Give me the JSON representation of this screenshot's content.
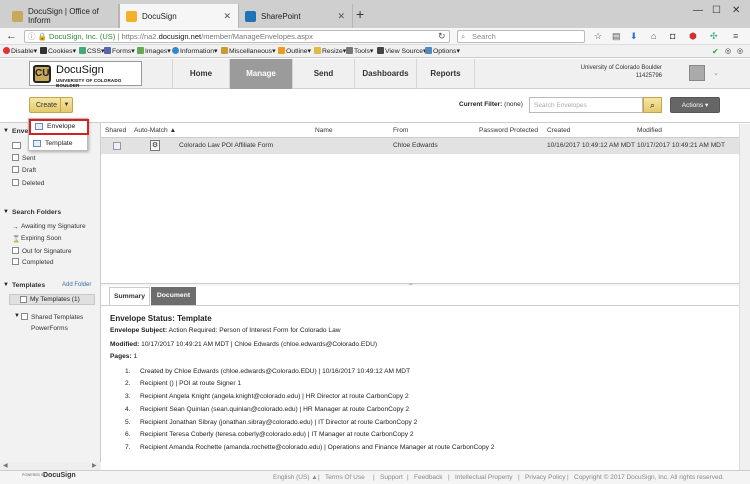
{
  "browser": {
    "tabs": [
      {
        "title": "DocuSign | Office of Inform"
      },
      {
        "title": "DocuSign"
      },
      {
        "title": "SharePoint"
      }
    ],
    "url_site": "DocuSign, Inc. (US)",
    "url_prefix": "https://na2.",
    "url_domain": "docusign.net",
    "url_path": "/member/ManageEnvelopes.aspx",
    "search_placeholder": "Search"
  },
  "devtoolbar": [
    "Disable",
    "Cookies",
    "CSS",
    "Forms",
    "Images",
    "Information",
    "Miscellaneous",
    "Outline",
    "Resize",
    "Tools",
    "View Source",
    "Options"
  ],
  "header": {
    "brand": "DocuSign",
    "brand_sub": "UNIVERSITY OF COLORADO BOULDER",
    "nav": [
      "Home",
      "Manage",
      "Send",
      "Dashboards",
      "Reports"
    ],
    "active_nav": "Manage",
    "account_name": "University of Colorado Boulder",
    "account_id": "11425796"
  },
  "toolbar": {
    "create_label": "Create",
    "filter_label": "Current Filter:",
    "filter_value": "(none)",
    "search_placeholder": "Search Envelopes",
    "actions_label": "Actions"
  },
  "dropdown": {
    "items": [
      "Envelope",
      "Template"
    ]
  },
  "sidebar": {
    "envelopes_head": "Enve",
    "envelope_items": [
      "Sent",
      "Draft",
      "Deleted"
    ],
    "search_head": "Search Folders",
    "search_items": [
      "Awaiting my Signature",
      "Expiring Soon",
      "Out for Signature",
      "Completed"
    ],
    "templates_head": "Templates",
    "add_folder": "Add Folder",
    "my_templates": "My Templates (1)",
    "shared_templates": "Shared Templates",
    "powerforms": "PowerForms"
  },
  "table": {
    "columns": [
      "Shared",
      "Auto-Match",
      "Name",
      "From",
      "Password Protected",
      "Created",
      "Modified"
    ],
    "rows": [
      {
        "name": "Colorado Law POI Affiliate Form",
        "from": "Chloe Edwards",
        "created": "10/16/2017 10:49:12 AM MDT",
        "modified": "10/17/2017 10:49:21 AM MDT"
      }
    ]
  },
  "summary": {
    "tabs": [
      "Summary",
      "Document"
    ],
    "status_label": "Envelope Status:",
    "status_value": "Template",
    "subject_label": "Envelope Subject:",
    "subject_value": "Action Required: Person of Interest Form for Colorado Law",
    "modified_label": "Modified:",
    "modified_value": "10/17/2017 10:49:21 AM MDT | Chloe Edwards (chloe.edwards@Colorado.EDU)",
    "pages_label": "Pages:",
    "pages_value": "1",
    "history": [
      "Created by Chloe Edwards (chloe.edwards@Colorado.EDU) | 10/16/2017 10:49:12 AM MDT",
      "Recipient () | POI at route Signer 1",
      "Recipient Angela Knight (angela.knight@colorado.edu) | HR Director at route CarbonCopy 2",
      "Recipient Sean Quinlan (sean.quinlan@colorado.edu) | HR Manager at route CarbonCopy 2",
      "Recipient Jonathan Sibray (jonathan.sibray@colorado.edu) | IT Director at route CarbonCopy 2",
      "Recipient Teresa Coberly (teresa.coberly@colorado.edu) | IT Manager at route CarbonCopy 2",
      "Recipient Amanda Rochette (amanda.rochette@colorado.edu) | Operations and Finance Manager at route CarbonCopy 2"
    ]
  },
  "footer": {
    "powered_by": "POWERED BY",
    "powered_brand": "DocuSign",
    "language": "English (US)",
    "links": [
      "Terms Of Use",
      "Support",
      "Feedback",
      "Intellectual Property",
      "Privacy Policy"
    ],
    "copyright": "Copyright © 2017 DocuSign, Inc. All rights reserved."
  }
}
